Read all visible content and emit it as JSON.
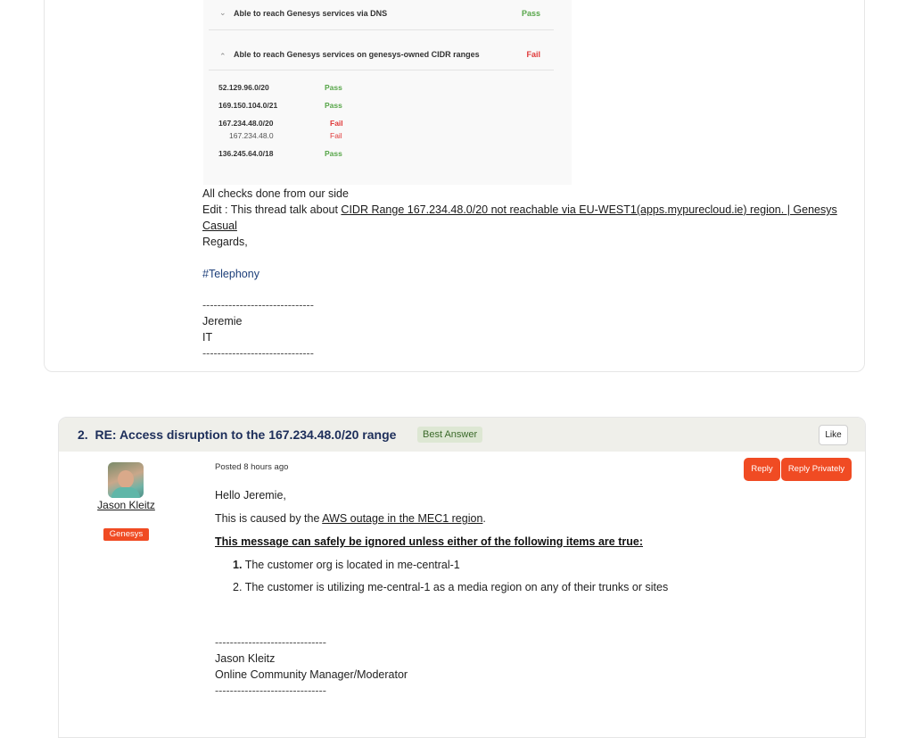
{
  "post1": {
    "screenshot": {
      "dns_label": "Able to reach Genesys services via DNS",
      "dns_status": "Pass",
      "cidr_label": "Able to reach Genesys services on genesys-owned CIDR ranges",
      "cidr_status": "Fail",
      "ranges": [
        {
          "range": "52.129.96.0/20",
          "status": "Pass"
        },
        {
          "range": "169.150.104.0/21",
          "status": "Pass"
        },
        {
          "range": "167.234.48.0/20",
          "status": "Fail"
        },
        {
          "range": "167.234.48.0",
          "status": "Fail"
        },
        {
          "range": "136.245.64.0/18",
          "status": "Pass"
        }
      ]
    },
    "body": {
      "line1": "All checks done from our side",
      "edit_prefix": "Edit : This thread talk about ",
      "edit_link_line1": "CIDR Range 167.234.48.0/20 not reachable via EU-WEST1(apps.mypurecloud.ie) region. | Genesys",
      "edit_link_line2": "Casual",
      "regards": "Regards,",
      "hashtag": "#Telephony",
      "sep": "------------------------------",
      "sig_name": "Jeremie",
      "sig_dept": "IT"
    }
  },
  "post2": {
    "number": "2.",
    "title": "RE: Access disruption to the 167.234.48.0/20 range",
    "best_answer": "Best Answer",
    "like_label": "Like",
    "author": {
      "name": "Jason Kleitz",
      "badge": "Genesys"
    },
    "posted": "Posted 8 hours ago",
    "reply_label": "Reply",
    "reply_private_label": "Reply Privately",
    "greeting": "Hello Jeremie,",
    "cause_prefix": "This is caused by the ",
    "cause_link": "AWS outage in the MEC1 region",
    "cause_suffix": ".",
    "warning": "This message can safely be ignored unless either of the following items are true:",
    "items": [
      {
        "num": "1.",
        "text": "The customer org is located in me-central-1"
      },
      {
        "num": "2.",
        "text": "The customer is utilizing me-central-1 as a media region on any of their trunks or sites"
      }
    ],
    "sep": "------------------------------",
    "sig_name": "Jason Kleitz",
    "sig_title": "Online Community Manager/Moderator"
  }
}
